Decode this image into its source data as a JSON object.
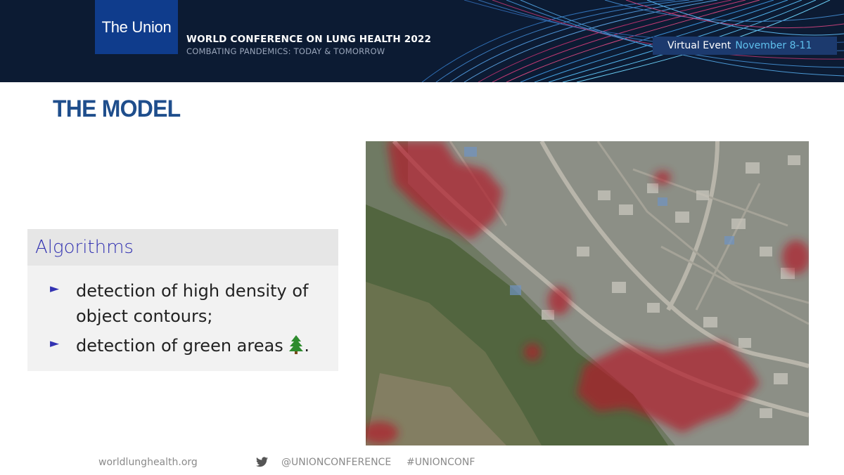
{
  "header": {
    "logo": "The Union",
    "conference_title": "WORLD CONFERENCE ON LUNG HEALTH 2022",
    "conference_subtitle": "COMBATING PANDEMICS: TODAY & TOMORROW",
    "event_label": "Virtual Event",
    "event_dates": "November 8-11",
    "colors": {
      "banner": "#0c1b33",
      "logo_box": "#0f3c8c",
      "event_box": "#1c3a6e",
      "dates": "#5fc0ee"
    }
  },
  "slide": {
    "title": "THE MODEL",
    "title_color": "#1f4e8c"
  },
  "algorithms": {
    "heading": "Algorithms",
    "items": [
      {
        "text": "detection of high density of object contours;"
      },
      {
        "text": "detection of green areas",
        "icon": "evergreen-tree-icon",
        "suffix": "."
      }
    ],
    "bullet_glyph": "►",
    "accent_color": "#3333b2"
  },
  "image": {
    "description_icon": "satellite-heatmap-image"
  },
  "footer": {
    "website": "worldlunghealth.org",
    "twitter_icon": "twitter-icon",
    "handle": "@UNIONCONFERENCE",
    "hashtag": "#UNIONCONF"
  }
}
